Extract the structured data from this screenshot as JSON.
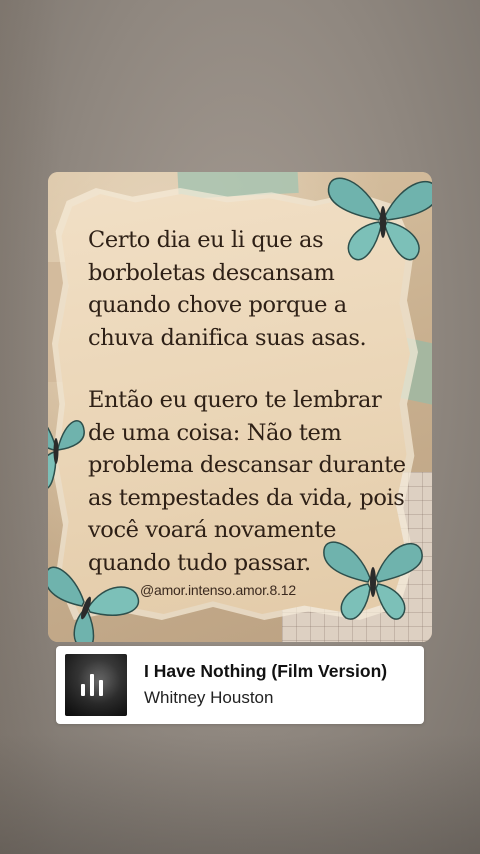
{
  "post": {
    "quote_paragraph_1": [
      "Certo dia eu li que as",
      "borboletas descansam",
      "quando chove porque a",
      "chuva danifica suas asas."
    ],
    "quote_paragraph_2": [
      "Então eu quero te lembrar",
      "de uma coisa: Não tem",
      "problema descansar durante",
      "as tempestades da vida, pois",
      "você voará novamente",
      "quando tudo passar."
    ],
    "watermark": "@amor.intenso.amor.8.12"
  },
  "music_sticker": {
    "title": "I Have Nothing (Film Version)",
    "artist": "Whitney Houston",
    "art_icon": "audio-bars-icon"
  },
  "colors": {
    "butterfly": "#6fb3ad",
    "paper": "#ead5b6",
    "text": "#2e2016"
  }
}
